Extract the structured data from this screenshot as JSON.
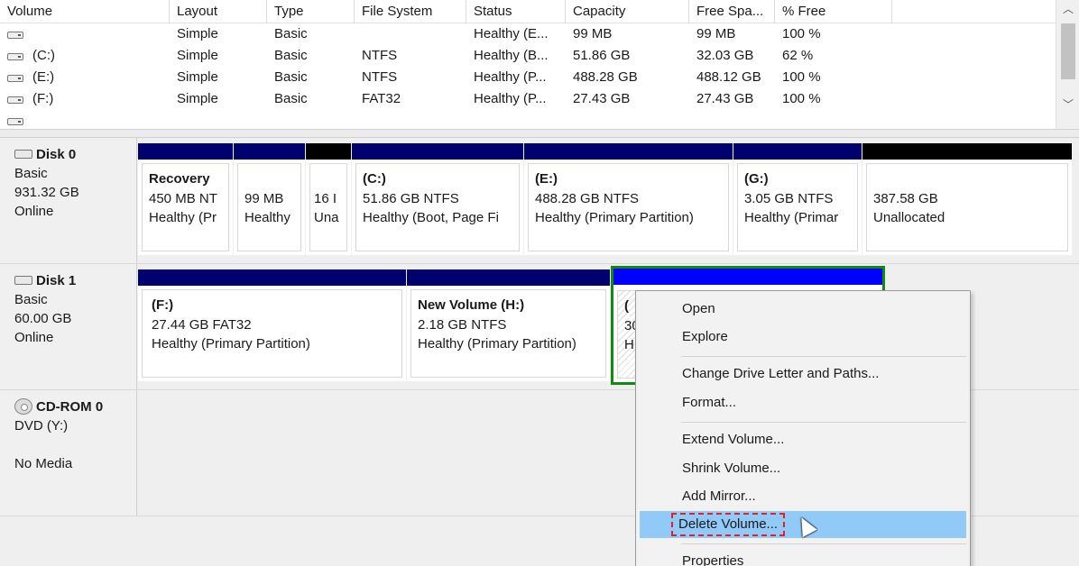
{
  "volume_list": {
    "columns": [
      "Volume",
      "Layout",
      "Type",
      "File System",
      "Status",
      "Capacity",
      "Free Spa...",
      "% Free"
    ],
    "rows": [
      {
        "volume": "",
        "layout": "Simple",
        "type": "Basic",
        "fs": "",
        "status": "Healthy (E...",
        "capacity": "99 MB",
        "free": "99 MB",
        "pct": "100 %"
      },
      {
        "volume": "(C:)",
        "layout": "Simple",
        "type": "Basic",
        "fs": "NTFS",
        "status": "Healthy (B...",
        "capacity": "51.86 GB",
        "free": "32.03 GB",
        "pct": "62 %"
      },
      {
        "volume": "(E:)",
        "layout": "Simple",
        "type": "Basic",
        "fs": "NTFS",
        "status": "Healthy (P...",
        "capacity": "488.28 GB",
        "free": "488.12 GB",
        "pct": "100 %"
      },
      {
        "volume": "(F:)",
        "layout": "Simple",
        "type": "Basic",
        "fs": "FAT32",
        "status": "Healthy (P...",
        "capacity": "27.43 GB",
        "free": "27.43 GB",
        "pct": "100 %"
      }
    ]
  },
  "disks": [
    {
      "name": "Disk 0",
      "type": "Basic",
      "size": "931.32 GB",
      "state": "Online",
      "partitions": [
        {
          "title": "Recovery",
          "line1": "450 MB NT",
          "line2": "Healthy (Pr"
        },
        {
          "title": "",
          "line1": "99 MB",
          "line2": "Healthy"
        },
        {
          "title": "",
          "line1": "16 I",
          "line2": "Una"
        },
        {
          "title": "(C:)",
          "line1": "51.86 GB NTFS",
          "line2": "Healthy (Boot, Page Fi"
        },
        {
          "title": "(E:)",
          "line1": "488.28 GB NTFS",
          "line2": "Healthy (Primary Partition)"
        },
        {
          "title": "(G:)",
          "line1": "3.05 GB NTFS",
          "line2": "Healthy (Primar"
        },
        {
          "title": "",
          "line1": "387.58 GB",
          "line2": "Unallocated"
        }
      ]
    },
    {
      "name": "Disk 1",
      "type": "Basic",
      "size": "60.00 GB",
      "state": "Online",
      "partitions": [
        {
          "title": "(F:)",
          "line1": "27.44 GB FAT32",
          "line2": "Healthy (Primary Partition)"
        },
        {
          "title": "New Volume  (H:)",
          "line1": "2.18 GB NTFS",
          "line2": "Healthy (Primary Partition)"
        },
        {
          "title": "(",
          "line1": "30",
          "line2": "H"
        }
      ]
    },
    {
      "name": "CD-ROM 0",
      "type": "DVD (Y:)",
      "size": "",
      "state": "No Media",
      "partitions": []
    }
  ],
  "context_menu": {
    "items": [
      "Open",
      "Explore",
      "Change Drive Letter and Paths...",
      "Format...",
      "Extend Volume...",
      "Shrink Volume...",
      "Add Mirror...",
      "Delete Volume...",
      "Properties"
    ],
    "highlighted": "Delete Volume..."
  },
  "colors": {
    "primary_partition_bar": "#00006e",
    "unallocated_bar": "#000000",
    "selected_bar": "#0000ff",
    "selection_border": "#128a12",
    "menu_highlight": "#91c9f7",
    "annotation_box": "#e0202a"
  }
}
